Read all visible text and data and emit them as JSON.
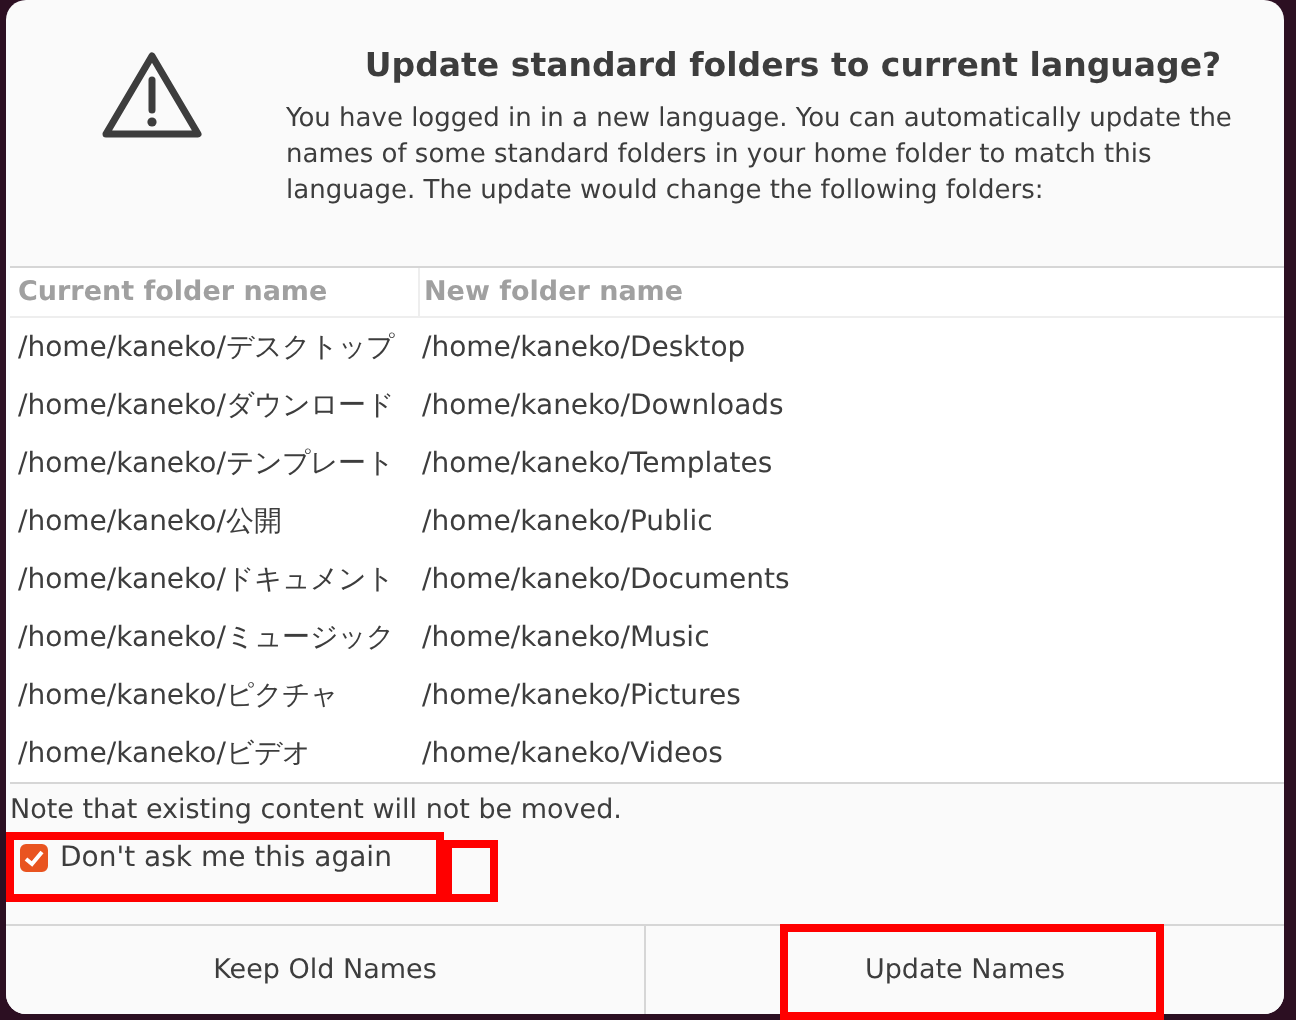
{
  "dialog": {
    "title": "Update standard folders to current language?",
    "message": "You have logged in in a new language. You can automatically update the names of some standard folders in your home folder to match this language. The update would change the following folders:"
  },
  "table": {
    "columns": [
      "Current folder name",
      "New folder name"
    ],
    "rows": [
      [
        "/home/kaneko/デスクトップ",
        "/home/kaneko/Desktop"
      ],
      [
        "/home/kaneko/ダウンロード",
        "/home/kaneko/Downloads"
      ],
      [
        "/home/kaneko/テンプレート",
        "/home/kaneko/Templates"
      ],
      [
        "/home/kaneko/公開",
        "/home/kaneko/Public"
      ],
      [
        "/home/kaneko/ドキュメント",
        "/home/kaneko/Documents"
      ],
      [
        "/home/kaneko/ミュージック",
        "/home/kaneko/Music"
      ],
      [
        "/home/kaneko/ピクチャ",
        "/home/kaneko/Pictures"
      ],
      [
        "/home/kaneko/ビデオ",
        "/home/kaneko/Videos"
      ]
    ]
  },
  "note": "Note that existing content will not be moved.",
  "checkbox": {
    "label": "Don't ask me this again",
    "checked": true
  },
  "buttons": [
    "Keep Old Names",
    "Update Names"
  ]
}
